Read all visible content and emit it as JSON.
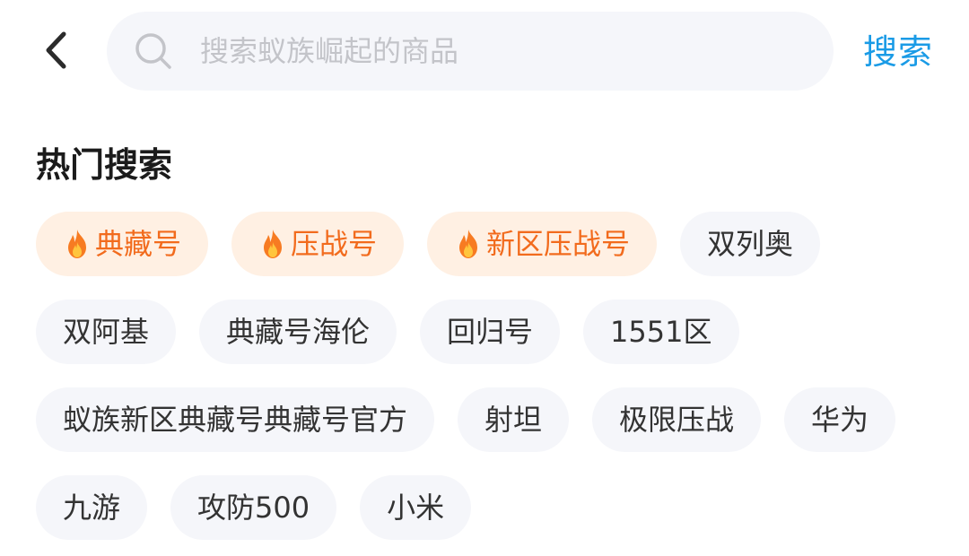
{
  "header": {
    "back_icon": "chevron-left-icon",
    "search_icon": "search-icon",
    "search_placeholder": "搜索蚁族崛起的商品",
    "search_value": "",
    "search_button_label": "搜索",
    "accent_color": "#1a9be6"
  },
  "hot_search": {
    "title": "热门搜索",
    "hot_color": "#f26b1d",
    "hot_bg_color": "#fff0e3",
    "tags": [
      {
        "label": "典藏号",
        "hot": true,
        "icon": "fire-icon"
      },
      {
        "label": "压战号",
        "hot": true,
        "icon": "fire-icon"
      },
      {
        "label": "新区压战号",
        "hot": true,
        "icon": "fire-icon"
      },
      {
        "label": "双列奥",
        "hot": false
      },
      {
        "label": "双阿基",
        "hot": false
      },
      {
        "label": "典藏号海伦",
        "hot": false
      },
      {
        "label": "回归号",
        "hot": false
      },
      {
        "label": "1551区",
        "hot": false
      },
      {
        "label": "蚁族新区典藏号典藏号官方",
        "hot": false
      },
      {
        "label": "射坦",
        "hot": false
      },
      {
        "label": "极限压战",
        "hot": false
      },
      {
        "label": "华为",
        "hot": false
      },
      {
        "label": "九游",
        "hot": false
      },
      {
        "label": "攻防500",
        "hot": false
      },
      {
        "label": "小米",
        "hot": false
      }
    ]
  }
}
